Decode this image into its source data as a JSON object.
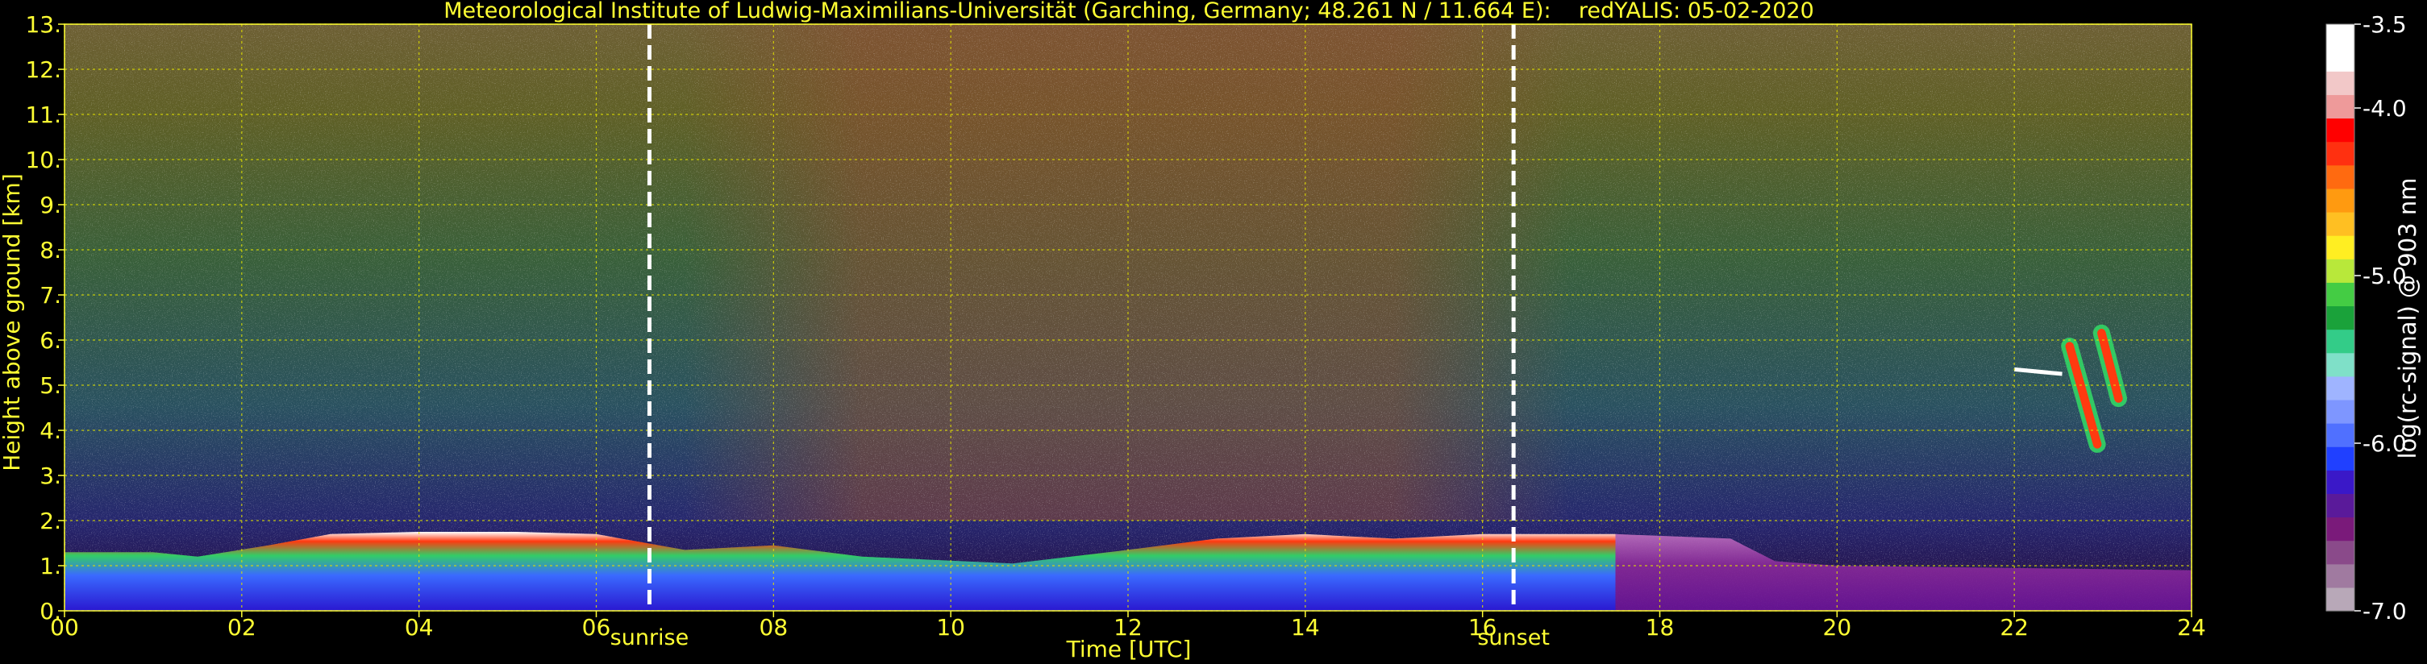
{
  "chart_data": {
    "type": "heatmap",
    "title": "Meteorological Institute of Ludwig-Maximilians-Universität (Garching, Germany; 48.261 N / 11.664 E):    redYALIS: 05-02-2020",
    "xlabel": "Time [UTC]",
    "ylabel": "Height above ground [km]",
    "xlim": [
      0,
      24
    ],
    "ylim": [
      0,
      13
    ],
    "x_ticks": [
      0,
      2,
      4,
      6,
      8,
      10,
      12,
      14,
      16,
      18,
      20,
      22,
      24
    ],
    "x_tick_labels": [
      "00",
      "02",
      "04",
      "06",
      "08",
      "10",
      "12",
      "14",
      "16",
      "18",
      "20",
      "22",
      "24"
    ],
    "y_ticks": [
      0,
      1,
      2,
      3,
      4,
      5,
      6,
      7,
      8,
      9,
      10,
      11,
      12,
      13
    ],
    "y_tick_labels": [
      "0.",
      "1.",
      "2.",
      "3.",
      "4.",
      "5.",
      "6.",
      "7.",
      "8.",
      "9.",
      "10.",
      "11.",
      "12.",
      "13."
    ],
    "grid": true,
    "markers": [
      {
        "label": "sunrise",
        "x": 6.6
      },
      {
        "label": "sunset",
        "x": 16.35
      }
    ],
    "colorbar": {
      "label": "log(rc-signal) @ 903 nm",
      "range": [
        -7.0,
        -3.5
      ],
      "ticks": [
        -3.5,
        -4.0,
        -5.0,
        -6.0,
        -7.0
      ],
      "tick_labels": [
        "-3.5",
        "-4.0",
        "-5.0",
        "-6.0",
        "-7.0"
      ],
      "colors": [
        "#b8a8b8",
        "#a07aa0",
        "#8a4a8a",
        "#7a1a7a",
        "#5a1a9a",
        "#3a18c8",
        "#2040ff",
        "#5070ff",
        "#7e96ff",
        "#9fb4ff",
        "#7fe0c8",
        "#33cc88",
        "#1aa23a",
        "#44cc44",
        "#b8e83a",
        "#ffee22",
        "#ffbf22",
        "#ff9a10",
        "#ff6a10",
        "#ff3010",
        "#ff0000",
        "#ee9a9a",
        "#f2c8c8",
        "#ffffff",
        "#ffffff"
      ]
    },
    "low_signal_layer_top_km": [
      [
        0,
        1.3
      ],
      [
        1,
        1.3
      ],
      [
        1.5,
        1.2
      ],
      [
        2.3,
        1.45
      ],
      [
        3,
        1.7
      ],
      [
        4,
        1.75
      ],
      [
        5.1,
        1.75
      ],
      [
        6,
        1.7
      ],
      [
        7,
        1.35
      ],
      [
        8,
        1.45
      ],
      [
        9,
        1.2
      ],
      [
        10.7,
        1.05
      ],
      [
        12,
        1.35
      ],
      [
        13,
        1.6
      ],
      [
        14,
        1.7
      ],
      [
        15,
        1.6
      ],
      [
        16,
        1.7
      ],
      [
        17.5,
        1.7
      ],
      [
        18.8,
        1.6
      ],
      [
        19.3,
        1.1
      ],
      [
        20,
        1.0
      ],
      [
        24,
        0.9
      ]
    ],
    "elevated_feature": {
      "x_range": [
        22.0,
        23.2
      ],
      "y_range": [
        3.4,
        6.3
      ]
    }
  }
}
